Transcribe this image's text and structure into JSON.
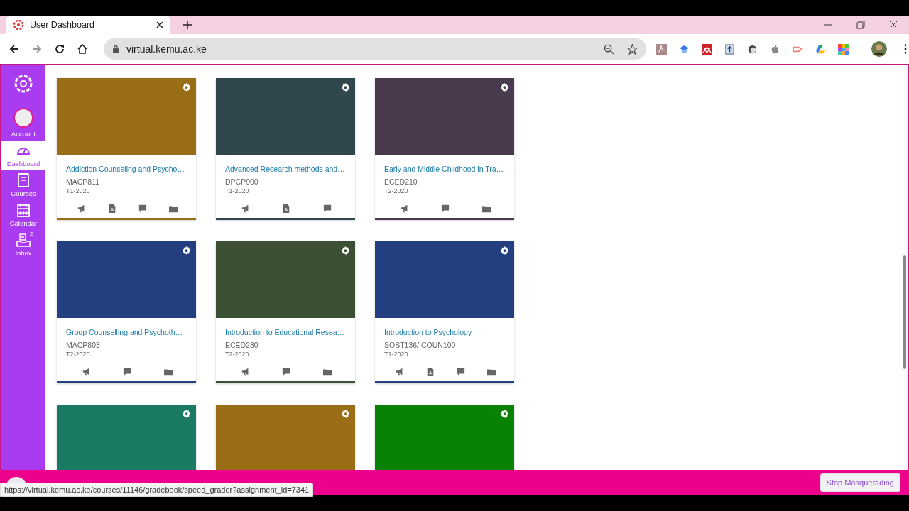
{
  "browser": {
    "tab_title": "User Dashboard",
    "url": "virtual.kemu.ac.ke",
    "status_url": "https://virtual.kemu.ac.ke/courses/11146/gradebook/speed_grader?assignment_id=7341"
  },
  "sidebar": {
    "items": [
      {
        "kind": "account",
        "label": "Account",
        "selected": false
      },
      {
        "kind": "dashboard",
        "label": "Dashboard",
        "selected": true
      },
      {
        "kind": "courses",
        "label": "Courses",
        "selected": false
      },
      {
        "kind": "calendar",
        "label": "Calendar",
        "selected": false
      },
      {
        "kind": "inbox",
        "label": "Inbox",
        "selected": false,
        "badge": "2"
      }
    ]
  },
  "cards": [
    {
      "color": "#9a6e17",
      "title": "Addiction Counseling and Psycho…",
      "code": "MACP811",
      "term": "T1-2020",
      "actions": [
        {
          "kind": "announcements"
        },
        {
          "kind": "assignments"
        },
        {
          "kind": "discussions"
        },
        {
          "kind": "files"
        }
      ]
    },
    {
      "color": "#2f474d",
      "title": "Advanced Research methods and…",
      "code": "DPCP900",
      "term": "T1-2020",
      "actions": [
        {
          "kind": "announcements"
        },
        {
          "kind": "assignments"
        },
        {
          "kind": "discussions"
        }
      ]
    },
    {
      "color": "#4a3a4e",
      "title": "Early and Middle Childhood in Tra…",
      "code": "ECED210",
      "term": "T2-2020",
      "actions": [
        {
          "kind": "announcements"
        },
        {
          "kind": "discussions"
        },
        {
          "kind": "files"
        }
      ]
    },
    {
      "color": "#243f80",
      "title": "Group Counselling and Psychoth…",
      "code": "MACP803",
      "term": "T2-2020",
      "actions": [
        {
          "kind": "announcements"
        },
        {
          "kind": "discussions"
        },
        {
          "kind": "files"
        }
      ]
    },
    {
      "color": "#3b4f35",
      "title": "Introduction to Educational Resea…",
      "code": "ECED230",
      "term": "T2-2020",
      "actions": [
        {
          "kind": "announcements"
        },
        {
          "kind": "discussions"
        },
        {
          "kind": "files"
        }
      ]
    },
    {
      "color": "#243f80",
      "title": "Introduction to Psychology",
      "code": "SOST136/ COUN100",
      "term": "T1-2020",
      "actions": [
        {
          "kind": "announcements"
        },
        {
          "kind": "assignments"
        },
        {
          "kind": "discussions"
        },
        {
          "kind": "files"
        }
      ]
    },
    {
      "color": "#1b7a64"
    },
    {
      "color": "#9a6e17"
    },
    {
      "color": "#098203"
    }
  ],
  "masquerade": {
    "button": "Stop Masquerading"
  }
}
